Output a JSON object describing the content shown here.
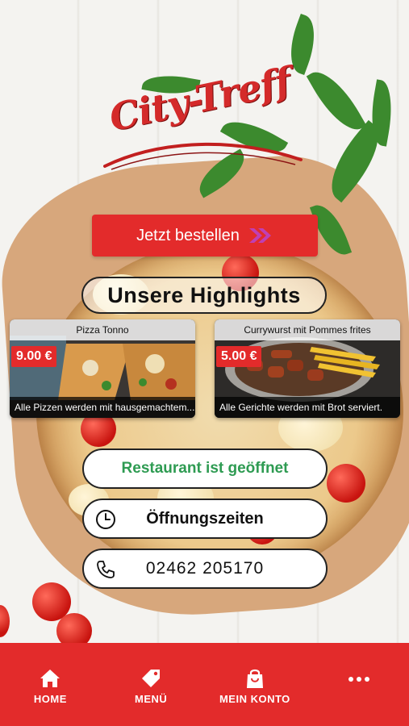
{
  "brand": {
    "logo_text": "City-Treff"
  },
  "order": {
    "label": "Jetzt bestellen"
  },
  "highlights": {
    "title": "Unsere Highlights",
    "items": [
      {
        "title": "Pizza Tonno",
        "price": "9.00 €",
        "description": "Alle Pizzen werden mit hausgemachtem..."
      },
      {
        "title": "Currywurst mit Pommes frites",
        "price": "5.00 €",
        "description": "Alle Gerichte werden mit Brot serviert."
      }
    ]
  },
  "info": {
    "status": "Restaurant ist geöffnet",
    "hours_label": "Öffnungszeiten",
    "phone": "02462 205170"
  },
  "nav": {
    "home": "HOME",
    "menu": "MENÜ",
    "account": "MEIN KONTO"
  },
  "colors": {
    "accent": "#e32b2b",
    "open_status": "#2e9b52"
  }
}
